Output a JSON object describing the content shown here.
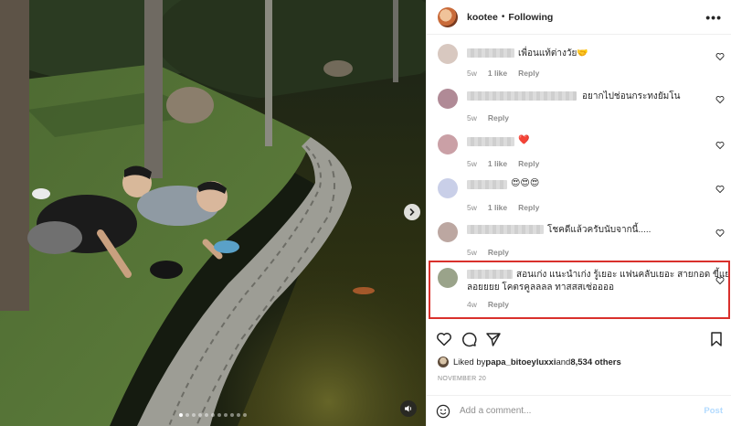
{
  "post": {
    "username": "kootee",
    "separator": "•",
    "follow_status": "Following",
    "more_glyph": "•••"
  },
  "media": {
    "carousel_dots": 11,
    "active_dot": 0,
    "next_glyph": "›"
  },
  "comments": [
    {
      "text": "เพื่อนแท้ต่างวัย",
      "emoji": "🤝",
      "age": "5w",
      "likes": "1 like",
      "reply": "Reply",
      "avatar_color": "#d8c8c0"
    },
    {
      "text": "อยากไปช่อนกระทงยัมโน",
      "emoji": "",
      "age": "5w",
      "likes": "",
      "reply": "Reply",
      "avatar_color": "#b08a96"
    },
    {
      "text": "",
      "emoji": "❤️",
      "age": "5w",
      "likes": "1 like",
      "reply": "Reply",
      "avatar_color": "#caa0a6"
    },
    {
      "text": "",
      "emoji": "😍😍😍",
      "age": "5w",
      "likes": "1 like",
      "reply": "Reply",
      "avatar_color": "#c9cfe8"
    },
    {
      "text": "โชคดีแล้วครับนับจากนี้.....",
      "emoji": "",
      "age": "5w",
      "likes": "",
      "reply": "Reply",
      "avatar_color": "#bca7a1"
    },
    {
      "text": "สอนเก่ง แนะนำเก่ง รู้เยอะ แฟนคลับเยอะ สายกอด ขี้แย",
      "text2": "ลอยยยย โคตรคูลลลล ทาสสสเซ่ออออ",
      "emoji": "",
      "age": "4w",
      "likes": "",
      "reply": "Reply",
      "avatar_color": "#9aa38a"
    }
  ],
  "liked_by": {
    "prefix": "Liked by ",
    "user": "papa_bitoeyluxxi",
    "and": " and ",
    "count": "8,534 others"
  },
  "date": "NOVEMBER 20",
  "add_comment": {
    "placeholder": "Add a comment...",
    "post_label": "Post"
  },
  "icons": [
    "more-icon",
    "heart-icon",
    "comment-icon",
    "share-icon",
    "bookmark-icon",
    "emoji-icon",
    "sound-icon",
    "chevron-right-icon"
  ],
  "colors": {
    "highlight": "#d9302c",
    "post_disabled": "#b3dbff",
    "meta_gray": "#8e8e8e",
    "heart_red": "#ed4956"
  }
}
